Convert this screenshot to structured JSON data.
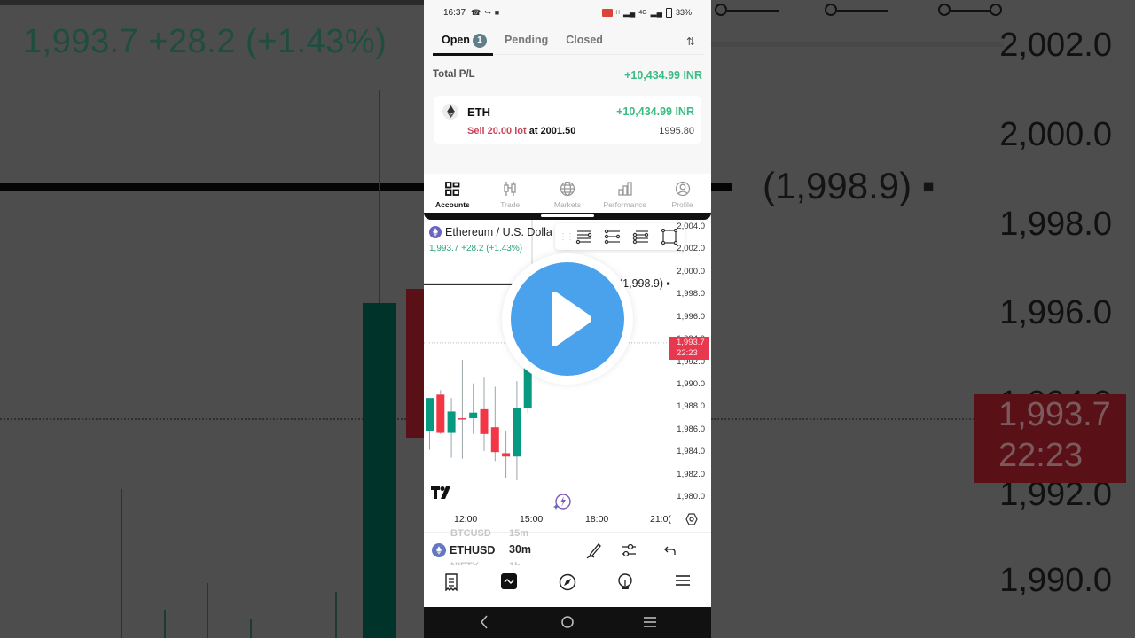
{
  "status_bar": {
    "time": "16:37",
    "left_icons": [
      "whatsapp-icon",
      "missed-call-icon",
      "video-icon"
    ],
    "right_icons": [
      "cast-icon",
      "volte-icon",
      "signal-icon",
      "4g-signal-icon",
      "battery-icon"
    ],
    "network_label": "4G",
    "battery": "33%"
  },
  "positions": {
    "tabs": [
      {
        "label": "Open",
        "count": "1",
        "active": true
      },
      {
        "label": "Pending",
        "active": false
      },
      {
        "label": "Closed",
        "active": false
      }
    ],
    "sort_icon": "sort-arrows-icon",
    "total_pl_label": "Total P/L",
    "total_pl_value": "+10,434.99 INR",
    "items": [
      {
        "symbol": "ETH",
        "pl": "+10,434.99 INR",
        "side": "Sell 20.00 lot",
        "at_label": "at",
        "open_price": "2001.50",
        "current_price": "1995.80"
      }
    ]
  },
  "bottom_nav": [
    {
      "label": "Accounts",
      "icon": "accounts-grid-icon",
      "active": true
    },
    {
      "label": "Trade",
      "icon": "candles-icon",
      "active": false
    },
    {
      "label": "Markets",
      "icon": "globe-icon",
      "active": false
    },
    {
      "label": "Performance",
      "icon": "bar-chart-icon",
      "active": false
    },
    {
      "label": "Profile",
      "icon": "profile-icon",
      "active": false
    }
  ],
  "chart": {
    "symbol_title": "Ethereum / U.S. Dolla",
    "ohlc": "1,993.7  +28.2 (+1.43%)",
    "ref_line_label": "(1,998.9) ▪",
    "last_price": "1,993.7",
    "countdown": "22:23",
    "drawing_tools": [
      "horizontal-line-tool-icon",
      "trend-line-tool-icon",
      "parallel-channel-tool-icon",
      "rectangle-tool-icon"
    ],
    "colors": {
      "up": "#089981",
      "down": "#f23645",
      "accent": "#4aa1ec"
    }
  },
  "chart_data": {
    "type": "candlestick",
    "title": "Ethereum / U.S. Dollar",
    "interval": "30m",
    "ylim": [
      1979,
      2004.5
    ],
    "y_ticks": [
      "2,004.0",
      "2,002.0",
      "2,000.0",
      "1,998.0",
      "1,996.0",
      "1,994.0",
      "1,992.0",
      "1,990.0",
      "1,988.0",
      "1,986.0",
      "1,984.0",
      "1,982.0",
      "1,980.0"
    ],
    "y_tick_values": [
      2004,
      2002,
      2000,
      1998,
      1996,
      1994,
      1992,
      1990,
      1988,
      1986,
      1984,
      1982,
      1980
    ],
    "x_ticks": [
      "12:00",
      "15:00",
      "18:00",
      "21:0("
    ],
    "reference_line": 1998.9,
    "last_price": 1993.7,
    "candles": [
      {
        "o": 1985.9,
        "h": 1987.2,
        "l": 1984.2,
        "c": 1988.8
      },
      {
        "o": 1989.1,
        "h": 1989.5,
        "l": 1985.6,
        "c": 1985.7
      },
      {
        "o": 1985.7,
        "h": 1988.8,
        "l": 1983.5,
        "c": 1987.6
      },
      {
        "o": 1987.0,
        "h": 1992.2,
        "l": 1983.4,
        "c": 1986.9
      },
      {
        "o": 1987.0,
        "h": 1990.1,
        "l": 1985.6,
        "c": 1987.5
      },
      {
        "o": 1987.8,
        "h": 1990.6,
        "l": 1984.1,
        "c": 1985.6
      },
      {
        "o": 1986.2,
        "h": 1989.8,
        "l": 1983.2,
        "c": 1984.0
      },
      {
        "o": 1983.9,
        "h": 1985.9,
        "l": 1981.7,
        "c": 1983.6
      },
      {
        "o": 1983.6,
        "h": 1990.3,
        "l": 1981.5,
        "c": 1987.9
      },
      {
        "o": 1987.9,
        "h": 1999.5,
        "l": 1987.5,
        "c": 1992.8
      }
    ]
  },
  "chart_toolbar": {
    "ghost_above": [
      "BTCUSD",
      "15m"
    ],
    "symbol": "ETHUSD",
    "interval": "30m",
    "ghost_below": [
      "NIFTY",
      "1h"
    ],
    "icons": [
      "pencil-draw-icon",
      "indicators-sliders-icon",
      "undo-icon"
    ]
  },
  "app_bar": [
    "watchlist-icon",
    "chart-icon",
    "explore-compass-icon",
    "ideas-bulb-icon",
    "menu-icon"
  ],
  "android_nav": [
    "back-icon",
    "home-icon",
    "recents-icon"
  ],
  "background": {
    "left_quote": "1,993.7  +28.2 (+1.43%)",
    "right_ref_label": "(1,998.9) ▪",
    "right_axis": [
      "2,002.0",
      "2,000.0",
      "1,998.0",
      "1,996.0",
      "1,994.0",
      "1,992.0",
      "1,990.0"
    ],
    "right_tag_price": "1,993.7",
    "right_tag_time": "22:23"
  }
}
